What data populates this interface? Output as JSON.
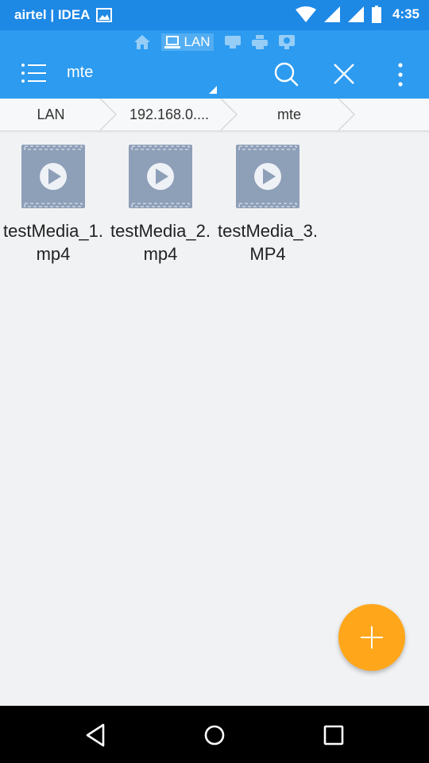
{
  "status_bar": {
    "carrier": "airtel | IDEA",
    "time": "4:35"
  },
  "toolbar": {
    "category_label": "LAN",
    "title": "mte"
  },
  "breadcrumb": [
    "LAN",
    "192.168.0....",
    "mte"
  ],
  "files": [
    {
      "name": "testMedia_1.mp4",
      "icon": "video-file-icon"
    },
    {
      "name": "testMedia_2.mp4",
      "icon": "video-file-icon"
    },
    {
      "name": "testMedia_3.MP4",
      "icon": "video-file-icon"
    }
  ],
  "colors": {
    "status_bar": "#1e88e5",
    "toolbar": "#2c9bf0",
    "background": "#f1f2f4",
    "fab": "#ffa61a",
    "thumbnail": "#8e9fb8"
  }
}
